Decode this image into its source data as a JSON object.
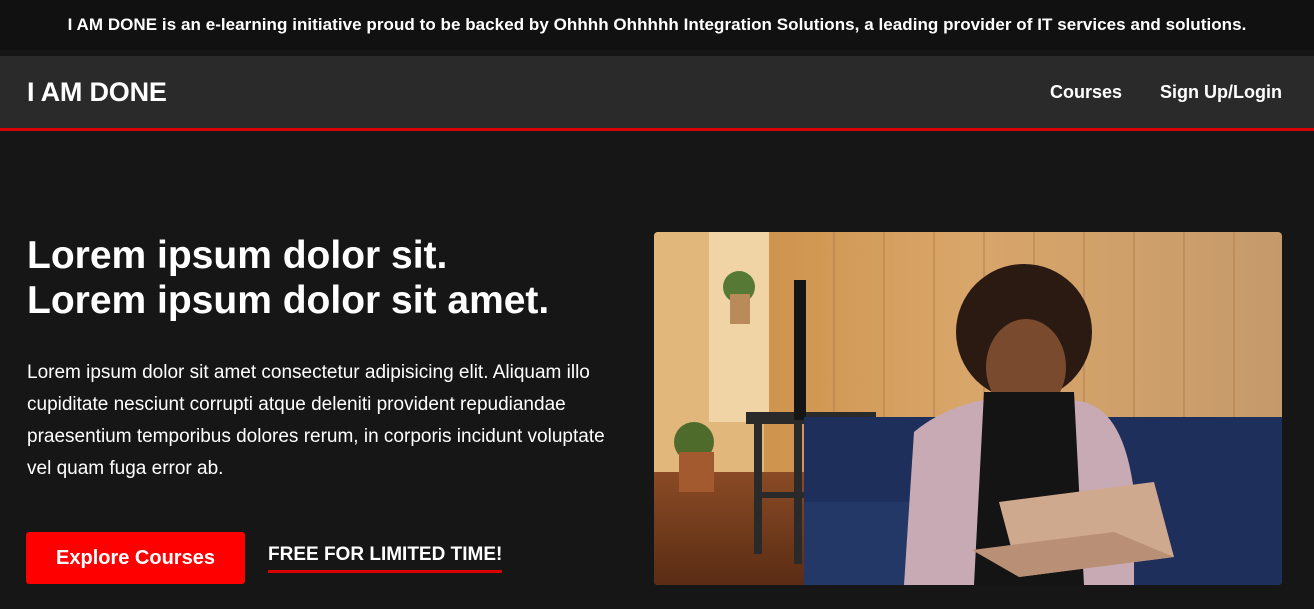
{
  "banner": {
    "text": "I AM DONE is an e-learning initiative proud to be backed by Ohhhh Ohhhhh Integration Solutions, a leading provider of IT services and solutions."
  },
  "nav": {
    "logo": "I AM DONE",
    "links": [
      {
        "label": "Courses"
      },
      {
        "label": "Sign Up/Login"
      }
    ]
  },
  "hero": {
    "title_line1": "Lorem ipsum dolor sit.",
    "title_line2": "Lorem ipsum dolor sit amet.",
    "description": "Lorem ipsum dolor sit amet consectetur adipisicing elit. Aliquam illo cupiditate nesciunt corrupti atque deleniti provident repudiandae praesentium temporibus dolores rerum, in corporis incidunt voluptate vel quam fuga error ab.",
    "primary_button": "Explore Courses",
    "secondary_link": "FREE FOR LIMITED TIME!"
  },
  "colors": {
    "accent": "#ff0000",
    "underline": "#d90000",
    "background": "#161616",
    "nav_bg": "#2a2a2a"
  }
}
